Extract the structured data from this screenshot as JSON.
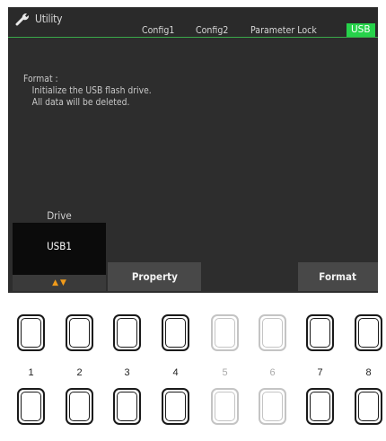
{
  "header": {
    "app_icon": "wrench-icon",
    "title": "Utility",
    "tabs": [
      {
        "label": "Config1",
        "active": false
      },
      {
        "label": "Config2",
        "active": false
      },
      {
        "label": "Parameter Lock",
        "active": false
      },
      {
        "label": "USB",
        "active": true
      }
    ]
  },
  "message": {
    "heading": "Format :",
    "line1": "Initialize the USB flash drive.",
    "line2": "All data will be deleted."
  },
  "drive": {
    "label": "Drive",
    "value": "USB1",
    "arrow_up": "▲",
    "arrow_down": "▼"
  },
  "softkeys": {
    "property": "Property",
    "format": "Format"
  },
  "colors": {
    "screen_bg": "#2d2d2d",
    "active_tab": "#26d24a",
    "arrow_accent": "#f09a1a"
  },
  "buttons": {
    "numbers": [
      "1",
      "2",
      "3",
      "4",
      "5",
      "6",
      "7",
      "8"
    ]
  }
}
